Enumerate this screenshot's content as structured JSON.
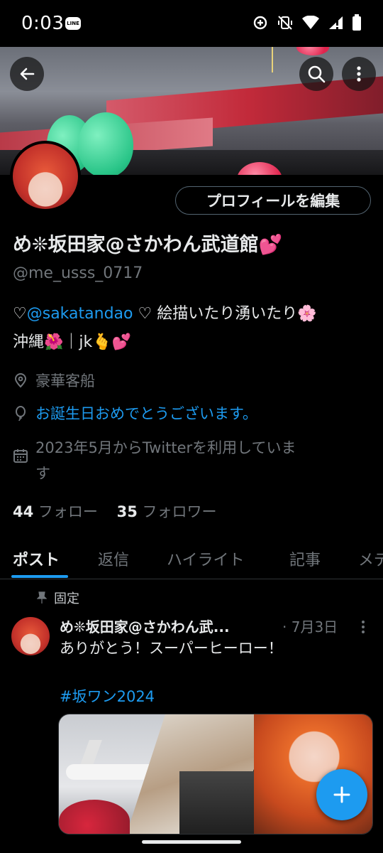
{
  "status_bar": {
    "time": "0:03",
    "line_badge": "LINE"
  },
  "profile": {
    "display_name": "め❊坂田家@さかわん武道館💕",
    "handle": "@me_usss_0717",
    "bio_prefix": "♡",
    "bio_mention": "@sakatandao",
    "bio_line1_rest": " ♡ 絵描いたり湧いたり🌸",
    "bio_line2": "沖縄🌺｜jk🫰💕",
    "location": "豪華客船",
    "birthday": "お誕生日おめでとうございます。",
    "joined": "2023年5月からTwitterを利用していま",
    "joined_cont": "す",
    "following_count": "44",
    "following_label": "フォロー",
    "followers_count": "35",
    "followers_label": "フォロワー",
    "edit_button": "プロフィールを編集"
  },
  "tabs": [
    "ポスト",
    "返信",
    "ハイライト",
    "記事",
    "メデ"
  ],
  "post": {
    "pinned_label": "固定",
    "author": "め❊坂田家@さかわん武...",
    "date": "· 7月3日",
    "text": "ありがとう！スーパーヒーロー！",
    "hashtag": "#坂ワン2024"
  },
  "colors": {
    "accent": "#1d9bf0",
    "background": "#000000",
    "muted": "#71767b"
  },
  "icons": [
    "back-arrow-icon",
    "search-icon",
    "more-vertical-icon",
    "location-pin-icon",
    "balloon-icon",
    "calendar-icon",
    "pin-icon",
    "plus-icon"
  ]
}
